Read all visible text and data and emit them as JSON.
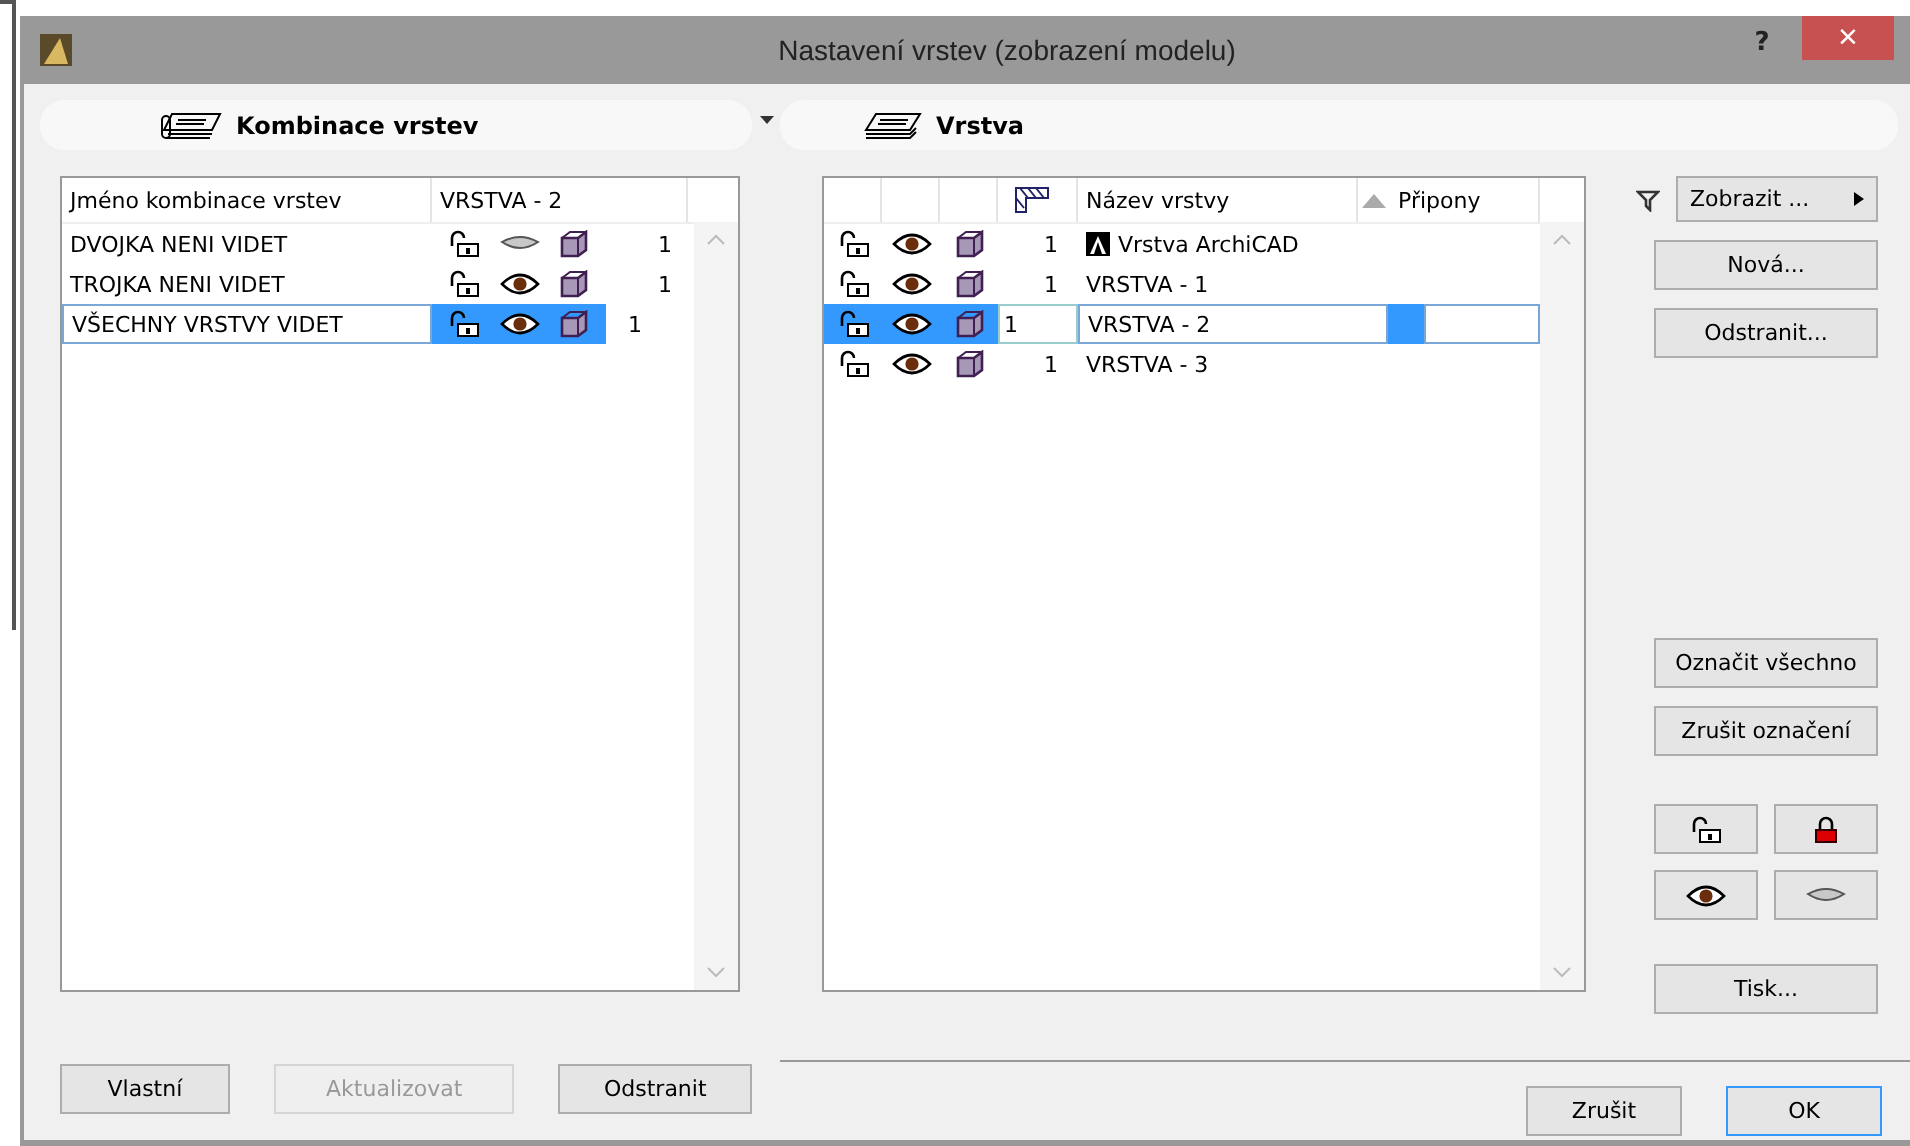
{
  "window": {
    "title": "Nastavení vrstev (zobrazení modelu)",
    "help": "?",
    "close": "×"
  },
  "combinations": {
    "header": "Kombinace vrstev",
    "columns": [
      "Jméno kombinace vrstev",
      "VRSTVA - 2"
    ],
    "rows": [
      {
        "name": "DVOJKA NENI VIDET",
        "locked": false,
        "visible": false,
        "number": "1",
        "selected": false
      },
      {
        "name": "TROJKA NENI VIDET",
        "locked": false,
        "visible": true,
        "number": "1",
        "selected": false
      },
      {
        "name": "VŠECHNY VRSTVY VIDET",
        "locked": false,
        "visible": true,
        "number": "1",
        "selected": true
      }
    ],
    "buttons": [
      {
        "label": "Vlastní",
        "disabled": false
      },
      {
        "label": "Aktualizovat",
        "disabled": true
      },
      {
        "label": "Odstranit",
        "disabled": false
      }
    ]
  },
  "layers": {
    "header": "Vrstva",
    "columns": [
      "Název vrstvy",
      "Připony"
    ],
    "rows": [
      {
        "name": "Vrstva ArchiCAD",
        "kind": "system",
        "locked": false,
        "visible": true,
        "number": "1",
        "selected": false
      },
      {
        "name": "VRSTVA - 1",
        "kind": "user",
        "locked": false,
        "visible": true,
        "number": "1",
        "selected": false
      },
      {
        "name": "VRSTVA - 2",
        "kind": "user",
        "locked": false,
        "visible": true,
        "number": "1",
        "selected": true
      },
      {
        "name": "VRSTVA - 3",
        "kind": "user",
        "locked": false,
        "visible": true,
        "number": "1",
        "selected": false
      }
    ],
    "show_button": "Zobrazit ...",
    "buttons": [
      "Nová...",
      "Odstranit..."
    ],
    "select_buttons": [
      "Označit všechno",
      "Zrušit označení"
    ],
    "print_button": "Tisk..."
  },
  "footer": {
    "buttons": [
      {
        "label": "Zrušit",
        "default": false
      },
      {
        "label": "OK",
        "default": true
      }
    ]
  }
}
